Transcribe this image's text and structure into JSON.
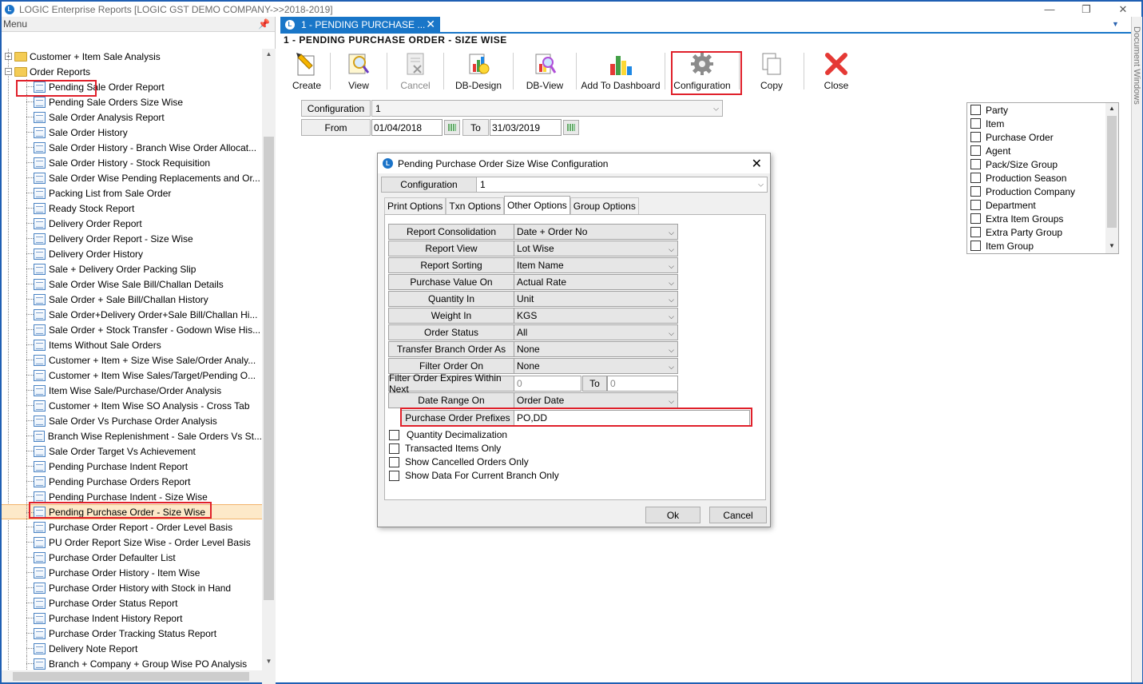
{
  "window": {
    "title": "LOGIC Enterprise Reports  [LOGIC GST DEMO COMPANY->>2018-2019]"
  },
  "menu": {
    "header": "Menu",
    "top_items": [
      "Customer + Item Sale Analysis",
      "Order Reports"
    ],
    "items": [
      "Pending Sale Order Report",
      "Pending Sale Orders Size Wise",
      "Sale Order Analysis Report",
      "Sale Order History",
      "Sale Order History - Branch Wise Order Allocat...",
      "Sale Order History - Stock Requisition",
      "Sale Order Wise Pending Replacements and Or...",
      "Packing List from Sale Order",
      "Ready Stock Report",
      "Delivery Order Report",
      "Delivery Order Report - Size Wise",
      "Delivery Order History",
      "Sale + Delivery Order Packing Slip",
      "Sale Order Wise Sale Bill/Challan Details",
      "Sale Order + Sale Bill/Challan History",
      "Sale Order+Delivery Order+Sale Bill/Challan Hi...",
      "Sale Order + Stock Transfer - Godown Wise His...",
      "Items Without Sale Orders",
      "Customer + Item + Size Wise Sale/Order Analy...",
      "Customer + Item Wise Sales/Target/Pending O...",
      "Item Wise Sale/Purchase/Order Analysis",
      "Customer + Item Wise SO Analysis - Cross Tab",
      "Sale Order Vs Purchase Order Analysis",
      "Branch Wise Replenishment - Sale Orders Vs St...",
      "Sale Order Target Vs Achievement",
      "Pending Purchase Indent Report",
      "Pending Purchase Orders Report",
      "Pending Purchase Indent - Size Wise",
      "Pending Purchase Order - Size Wise",
      "Purchase Order Report - Order Level Basis",
      "PU Order Report Size Wise - Order Level Basis",
      "Purchase Order Defaulter List",
      "Purchase Order History - Item Wise",
      "Purchase Order History with Stock in Hand",
      "Purchase Order Status Report",
      "Purchase Indent History Report",
      "Purchase Order Tracking Status Report",
      "Delivery Note Report",
      "Branch + Company + Group Wise PO Analysis"
    ],
    "selected_index": 28
  },
  "tab": {
    "label": "1 - PENDING PURCHASE ...",
    "close": "✕"
  },
  "side_panel": "Document Windows",
  "page_title": "1 - PENDING PURCHASE ORDER - SIZE WISE",
  "toolbar": [
    "Create",
    "View",
    "Cancel",
    "DB-Design",
    "DB-View",
    "Add To Dashboard",
    "Configuration",
    "Copy",
    "Close"
  ],
  "filters": {
    "configuration_label": "Configuration",
    "configuration_value": "1",
    "from_label": "From",
    "from_value": "01/04/2018",
    "to_label": "To",
    "to_value": "31/03/2019"
  },
  "checklist": [
    "Party",
    "Item",
    "Purchase Order",
    "Agent",
    "Pack/Size Group",
    "Production Season",
    "Production Company",
    "Department",
    "Extra Item Groups",
    "Extra Party Group",
    "Item Group"
  ],
  "dialog": {
    "title": "Pending Purchase Order Size Wise Configuration",
    "config_label": "Configuration",
    "config_value": "1",
    "tabs": [
      "Print Options",
      "Txn Options",
      "Other Options",
      "Group Options"
    ],
    "active_tab": 2,
    "options": [
      {
        "label": "Report Consolidation",
        "value": "Date + Order No"
      },
      {
        "label": "Report View",
        "value": "Lot Wise"
      },
      {
        "label": "Report Sorting",
        "value": "Item Name"
      },
      {
        "label": "Purchase Value On",
        "value": "Actual Rate"
      },
      {
        "label": "Quantity In",
        "value": "Unit"
      },
      {
        "label": "Weight In",
        "value": "KGS"
      },
      {
        "label": "Order Status",
        "value": "All"
      },
      {
        "label": "Transfer Branch Order As",
        "value": "None"
      },
      {
        "label": "Filter Order On",
        "value": "None"
      }
    ],
    "expires": {
      "label": "Filter Order Expires Within Next",
      "from": "0",
      "to_label": "To",
      "to": "0"
    },
    "date_range": {
      "label": "Date Range On",
      "value": "Order Date"
    },
    "prefixes": {
      "label": "Purchase Order Prefixes",
      "value": "PO,DD"
    },
    "checks": [
      "Quantity Decimalization",
      "Transacted Items Only",
      "Show Cancelled Orders Only",
      "Show Data For Current Branch Only"
    ],
    "ok": "Ok",
    "cancel": "Cancel"
  }
}
